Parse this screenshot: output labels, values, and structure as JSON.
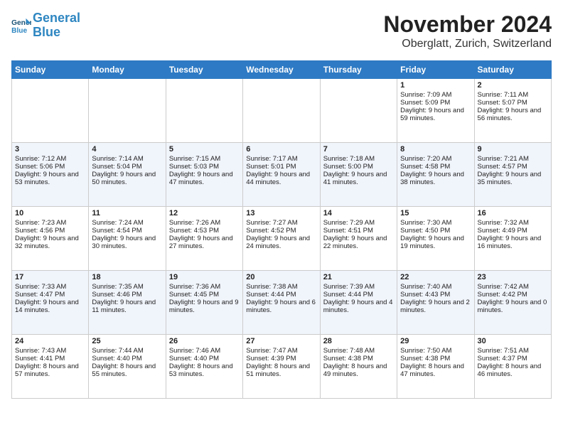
{
  "header": {
    "logo_line1": "General",
    "logo_line2": "Blue",
    "month_title": "November 2024",
    "location": "Oberglatt, Zurich, Switzerland"
  },
  "weekdays": [
    "Sunday",
    "Monday",
    "Tuesday",
    "Wednesday",
    "Thursday",
    "Friday",
    "Saturday"
  ],
  "weeks": [
    [
      {
        "day": "",
        "text": ""
      },
      {
        "day": "",
        "text": ""
      },
      {
        "day": "",
        "text": ""
      },
      {
        "day": "",
        "text": ""
      },
      {
        "day": "",
        "text": ""
      },
      {
        "day": "1",
        "text": "Sunrise: 7:09 AM\nSunset: 5:09 PM\nDaylight: 9 hours and 59 minutes."
      },
      {
        "day": "2",
        "text": "Sunrise: 7:11 AM\nSunset: 5:07 PM\nDaylight: 9 hours and 56 minutes."
      }
    ],
    [
      {
        "day": "3",
        "text": "Sunrise: 7:12 AM\nSunset: 5:06 PM\nDaylight: 9 hours and 53 minutes."
      },
      {
        "day": "4",
        "text": "Sunrise: 7:14 AM\nSunset: 5:04 PM\nDaylight: 9 hours and 50 minutes."
      },
      {
        "day": "5",
        "text": "Sunrise: 7:15 AM\nSunset: 5:03 PM\nDaylight: 9 hours and 47 minutes."
      },
      {
        "day": "6",
        "text": "Sunrise: 7:17 AM\nSunset: 5:01 PM\nDaylight: 9 hours and 44 minutes."
      },
      {
        "day": "7",
        "text": "Sunrise: 7:18 AM\nSunset: 5:00 PM\nDaylight: 9 hours and 41 minutes."
      },
      {
        "day": "8",
        "text": "Sunrise: 7:20 AM\nSunset: 4:58 PM\nDaylight: 9 hours and 38 minutes."
      },
      {
        "day": "9",
        "text": "Sunrise: 7:21 AM\nSunset: 4:57 PM\nDaylight: 9 hours and 35 minutes."
      }
    ],
    [
      {
        "day": "10",
        "text": "Sunrise: 7:23 AM\nSunset: 4:56 PM\nDaylight: 9 hours and 32 minutes."
      },
      {
        "day": "11",
        "text": "Sunrise: 7:24 AM\nSunset: 4:54 PM\nDaylight: 9 hours and 30 minutes."
      },
      {
        "day": "12",
        "text": "Sunrise: 7:26 AM\nSunset: 4:53 PM\nDaylight: 9 hours and 27 minutes."
      },
      {
        "day": "13",
        "text": "Sunrise: 7:27 AM\nSunset: 4:52 PM\nDaylight: 9 hours and 24 minutes."
      },
      {
        "day": "14",
        "text": "Sunrise: 7:29 AM\nSunset: 4:51 PM\nDaylight: 9 hours and 22 minutes."
      },
      {
        "day": "15",
        "text": "Sunrise: 7:30 AM\nSunset: 4:50 PM\nDaylight: 9 hours and 19 minutes."
      },
      {
        "day": "16",
        "text": "Sunrise: 7:32 AM\nSunset: 4:49 PM\nDaylight: 9 hours and 16 minutes."
      }
    ],
    [
      {
        "day": "17",
        "text": "Sunrise: 7:33 AM\nSunset: 4:47 PM\nDaylight: 9 hours and 14 minutes."
      },
      {
        "day": "18",
        "text": "Sunrise: 7:35 AM\nSunset: 4:46 PM\nDaylight: 9 hours and 11 minutes."
      },
      {
        "day": "19",
        "text": "Sunrise: 7:36 AM\nSunset: 4:45 PM\nDaylight: 9 hours and 9 minutes."
      },
      {
        "day": "20",
        "text": "Sunrise: 7:38 AM\nSunset: 4:44 PM\nDaylight: 9 hours and 6 minutes."
      },
      {
        "day": "21",
        "text": "Sunrise: 7:39 AM\nSunset: 4:44 PM\nDaylight: 9 hours and 4 minutes."
      },
      {
        "day": "22",
        "text": "Sunrise: 7:40 AM\nSunset: 4:43 PM\nDaylight: 9 hours and 2 minutes."
      },
      {
        "day": "23",
        "text": "Sunrise: 7:42 AM\nSunset: 4:42 PM\nDaylight: 9 hours and 0 minutes."
      }
    ],
    [
      {
        "day": "24",
        "text": "Sunrise: 7:43 AM\nSunset: 4:41 PM\nDaylight: 8 hours and 57 minutes."
      },
      {
        "day": "25",
        "text": "Sunrise: 7:44 AM\nSunset: 4:40 PM\nDaylight: 8 hours and 55 minutes."
      },
      {
        "day": "26",
        "text": "Sunrise: 7:46 AM\nSunset: 4:40 PM\nDaylight: 8 hours and 53 minutes."
      },
      {
        "day": "27",
        "text": "Sunrise: 7:47 AM\nSunset: 4:39 PM\nDaylight: 8 hours and 51 minutes."
      },
      {
        "day": "28",
        "text": "Sunrise: 7:48 AM\nSunset: 4:38 PM\nDaylight: 8 hours and 49 minutes."
      },
      {
        "day": "29",
        "text": "Sunrise: 7:50 AM\nSunset: 4:38 PM\nDaylight: 8 hours and 47 minutes."
      },
      {
        "day": "30",
        "text": "Sunrise: 7:51 AM\nSunset: 4:37 PM\nDaylight: 8 hours and 46 minutes."
      }
    ]
  ]
}
